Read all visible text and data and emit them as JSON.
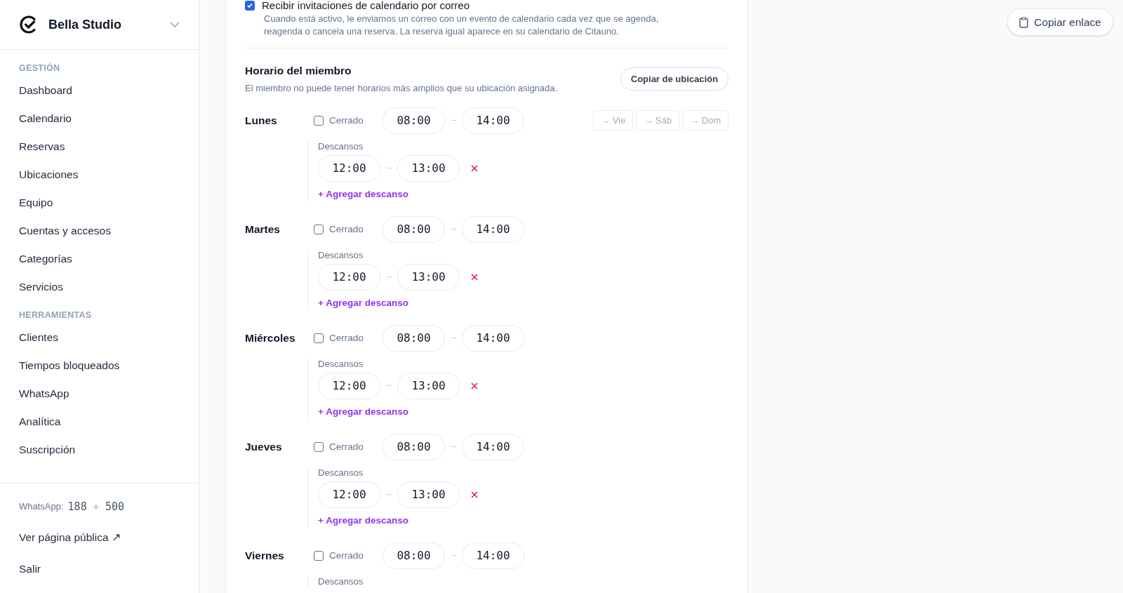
{
  "sidebar": {
    "brand": "Bella Studio",
    "groups": [
      {
        "label": "GESTIÓN",
        "items": [
          {
            "label": "Dashboard",
            "selected": false
          },
          {
            "label": "Calendario",
            "selected": false
          },
          {
            "label": "Reservas",
            "selected": false
          },
          {
            "label": "Ubicaciones",
            "selected": false
          },
          {
            "label": "Equipo",
            "selected": false
          },
          {
            "label": "Cuentas y accesos",
            "selected": false
          },
          {
            "label": "Categorías",
            "selected": false
          },
          {
            "label": "Servicios",
            "selected": false
          }
        ]
      },
      {
        "label": "HERRAMIENTAS",
        "items": [
          {
            "label": "Clientes",
            "selected": false
          },
          {
            "label": "Tiempos bloqueados",
            "selected": false
          },
          {
            "label": "WhatsApp",
            "selected": false
          },
          {
            "label": "Analítica",
            "selected": false
          },
          {
            "label": "Suscripción",
            "selected": false
          }
        ]
      }
    ],
    "footer": {
      "whatsapp_label": "WhatsApp:",
      "whatsapp_used": "188",
      "whatsapp_plus": "+",
      "whatsapp_total": "500",
      "public_link": "Ver página pública ↗",
      "logout": "Salir"
    }
  },
  "copy_link_button": "Copiar enlace",
  "email_invites": {
    "label": "Recibir invitaciones de calendario por correo",
    "checked": true,
    "description": "Cuando está activo, le enviamos un correo con un evento de calendario cada vez que se agenda, reagenda o cancela una reserva. La reserva igual aparece en su calendario de Citauno."
  },
  "schedule": {
    "title": "Horario del miembro",
    "subtitle": "El miembro no puede tener horarios más amplios que su ubicación asignada.",
    "copy_button": "Copiar de ubicación",
    "days": [
      {
        "name": "Lunes",
        "closed": false,
        "closed_label": "Cerrado",
        "start": "08:00",
        "end": "14:00",
        "copy_buttons": [
          "→ Vie",
          "→ Sáb",
          "→ Dom"
        ],
        "breaks_label": "Descansos",
        "breaks": [
          {
            "start": "12:00",
            "end": "13:00"
          }
        ],
        "add_break": "+ Agregar descanso"
      },
      {
        "name": "Martes",
        "closed": false,
        "closed_label": "Cerrado",
        "start": "08:00",
        "end": "14:00",
        "breaks_label": "Descansos",
        "breaks": [
          {
            "start": "12:00",
            "end": "13:00"
          }
        ],
        "add_break": "+ Agregar descanso"
      },
      {
        "name": "Miércoles",
        "closed": false,
        "closed_label": "Cerrado",
        "start": "08:00",
        "end": "14:00",
        "breaks_label": "Descansos",
        "breaks": [
          {
            "start": "12:00",
            "end": "13:00"
          }
        ],
        "add_break": "+ Agregar descanso"
      },
      {
        "name": "Jueves",
        "closed": false,
        "closed_label": "Cerrado",
        "start": "08:00",
        "end": "14:00",
        "breaks_label": "Descansos",
        "breaks": [
          {
            "start": "12:00",
            "end": "13:00"
          }
        ],
        "add_break": "+ Agregar descanso"
      },
      {
        "name": "Viernes",
        "closed": false,
        "closed_label": "Cerrado",
        "start": "08:00",
        "end": "14:00",
        "breaks_label": "Descansos"
      }
    ]
  }
}
